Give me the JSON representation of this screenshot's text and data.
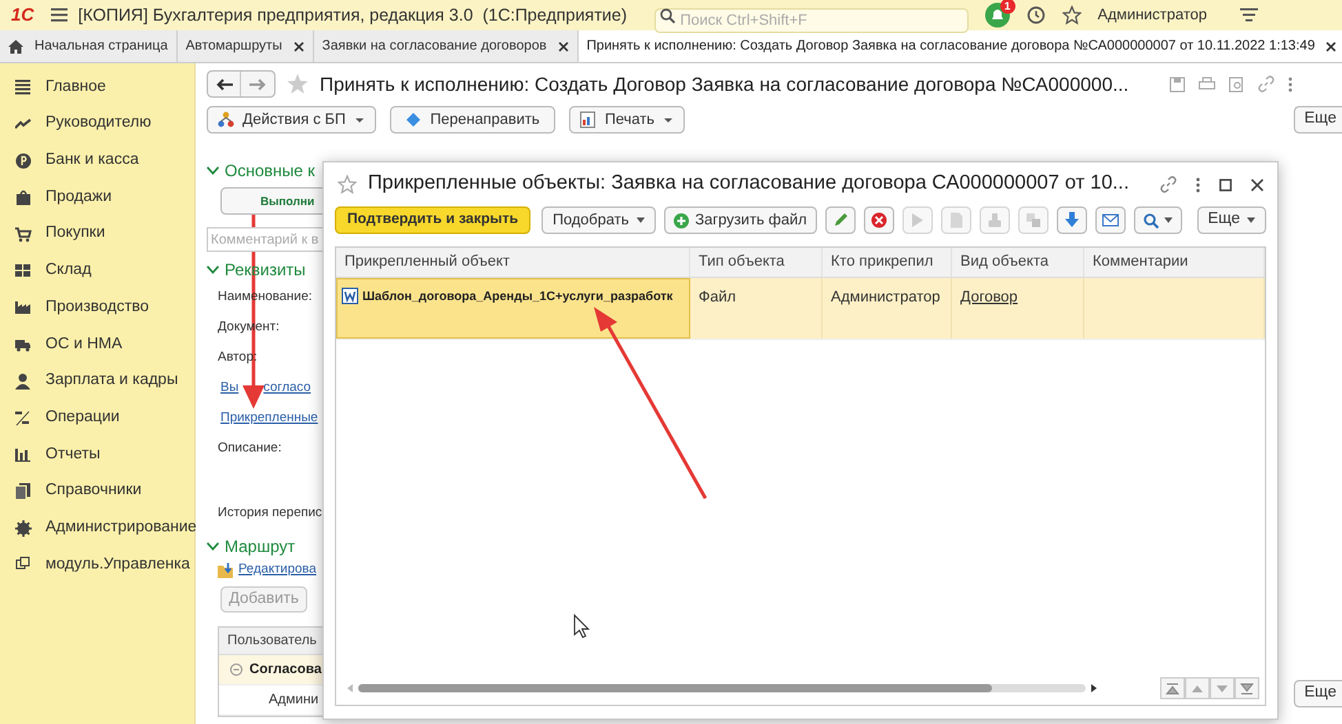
{
  "app_bar": {
    "logo": "1С",
    "title": "[КОПИЯ] Бухгалтерия предприятия, редакция 3.0  (1С:Предприятие)",
    "search": {
      "placeholder": "Поиск Ctrl+Shift+F"
    },
    "notifications_badge": "1",
    "user": "Администратор"
  },
  "tabs": [
    {
      "label": "Начальная страница",
      "kind": "home",
      "selected": false
    },
    {
      "label": "Автомаршруты",
      "kind": "document",
      "selected": false
    },
    {
      "label": "Заявки на согласование договоров",
      "kind": "document",
      "selected": false
    },
    {
      "label": "Принять к исполнению: Создать Договор Заявка на согласование договора №СА000000007 от 10.11.2022 1:13:49",
      "kind": "document",
      "selected": true
    }
  ],
  "sidebar": {
    "items": [
      {
        "label": "Главное"
      },
      {
        "label": "Руководителю"
      },
      {
        "label": "Банк и касса"
      },
      {
        "label": "Продажи"
      },
      {
        "label": "Покупки"
      },
      {
        "label": "Склад"
      },
      {
        "label": "Производство"
      },
      {
        "label": "ОС и НМА"
      },
      {
        "label": "Зарплата и кадры"
      },
      {
        "label": "Операции"
      },
      {
        "label": "Отчеты"
      },
      {
        "label": "Справочники"
      },
      {
        "label": "Администрирование"
      },
      {
        "label": "модуль.Управленка"
      }
    ]
  },
  "form": {
    "title": "Принять к исполнению: Создать Договор Заявка на согласование договора №СА000000...",
    "toolbar": [
      {
        "label": "Действия с БП",
        "dropdown": true
      },
      {
        "label": "Перенаправить",
        "dropdown": false
      },
      {
        "label": "Печать",
        "dropdown": true
      }
    ],
    "more_button": "Еще",
    "fields": [
      {
        "kind": "section",
        "label": "Основные к"
      },
      {
        "kind": "button",
        "label": "Выполни"
      },
      {
        "kind": "input",
        "placeholder": "Комментарий к в"
      },
      {
        "kind": "section",
        "label": "Реквизиты"
      },
      {
        "kind": "label",
        "label": "Наименование:"
      },
      {
        "kind": "label",
        "label": "Документ:"
      },
      {
        "kind": "label",
        "label": "Автор:"
      },
      {
        "kind": "split_link",
        "parts": [
          "Вы",
          "согласо"
        ]
      },
      {
        "kind": "link",
        "label": "Прикрепленные"
      },
      {
        "kind": "multiline",
        "label": "Описание:"
      },
      {
        "kind": "label",
        "label": "История перепис"
      },
      {
        "kind": "section",
        "label": "Маршрут"
      },
      {
        "kind": "iconlink",
        "label": "Редактирова"
      },
      {
        "kind": "disabled_button",
        "label": "Добавить"
      }
    ],
    "route_table": {
      "header": "Пользователь",
      "rows": [
        {
          "label": "Согласова",
          "group": true
        },
        {
          "label": "Админи",
          "group": false
        }
      ]
    },
    "footer_more": "Еще"
  },
  "dialog": {
    "title": "Прикрепленные объекты: Заявка на согласование договора СА000000007 от 10...",
    "buttons": [
      {
        "label": "Подтвердить и закрыть",
        "kind": "primary"
      },
      {
        "label": "Подобрать",
        "kind": "dropdown"
      },
      {
        "label": "Загрузить файл",
        "kind": "add"
      }
    ],
    "icon_buttons": [
      {
        "disabled": false
      },
      {
        "disabled": false
      },
      {
        "disabled": true
      },
      {
        "disabled": true
      },
      {
        "disabled": true
      },
      {
        "disabled": true
      },
      {
        "disabled": false
      },
      {
        "disabled": false
      }
    ],
    "more_button": "Еще",
    "table": {
      "columns": [
        "Прикрепленный объект",
        "Тип объекта",
        "Кто прикрепил",
        "Вид объекта",
        "Комментарии"
      ],
      "rows": [
        {
          "selected": true,
          "cells": [
            "Шаблон_договора_Аренды_1С+услуги_разработк",
            "Файл",
            "Администратор",
            "Договор"
          ]
        }
      ]
    }
  }
}
